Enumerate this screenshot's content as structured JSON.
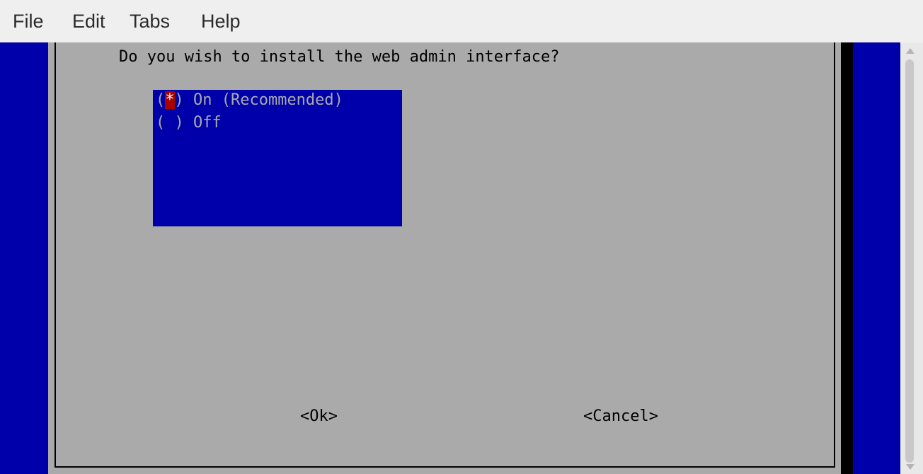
{
  "menubar": {
    "items": [
      "File",
      "Edit",
      "Tabs",
      "Help"
    ]
  },
  "dialog": {
    "prompt": "Do you wish to install the web admin interface?",
    "options": [
      {
        "mark_open": "(",
        "mark": "*",
        "label": ") On (Recommended)",
        "selected": true
      },
      {
        "mark_open": "(",
        "mark": " ",
        "label": ") Off",
        "selected": false
      }
    ],
    "buttons": {
      "ok": "<Ok>",
      "cancel": "<Cancel>"
    }
  },
  "colors": {
    "terminal_bg": "#0000aa",
    "dialog_bg": "#aaaaaa",
    "cursor": "#aa0000",
    "option_text": "#aaaaaa"
  },
  "icons": {
    "scroll_up": "scroll-up-arrow",
    "scroll_down": "scroll-down-arrow"
  }
}
